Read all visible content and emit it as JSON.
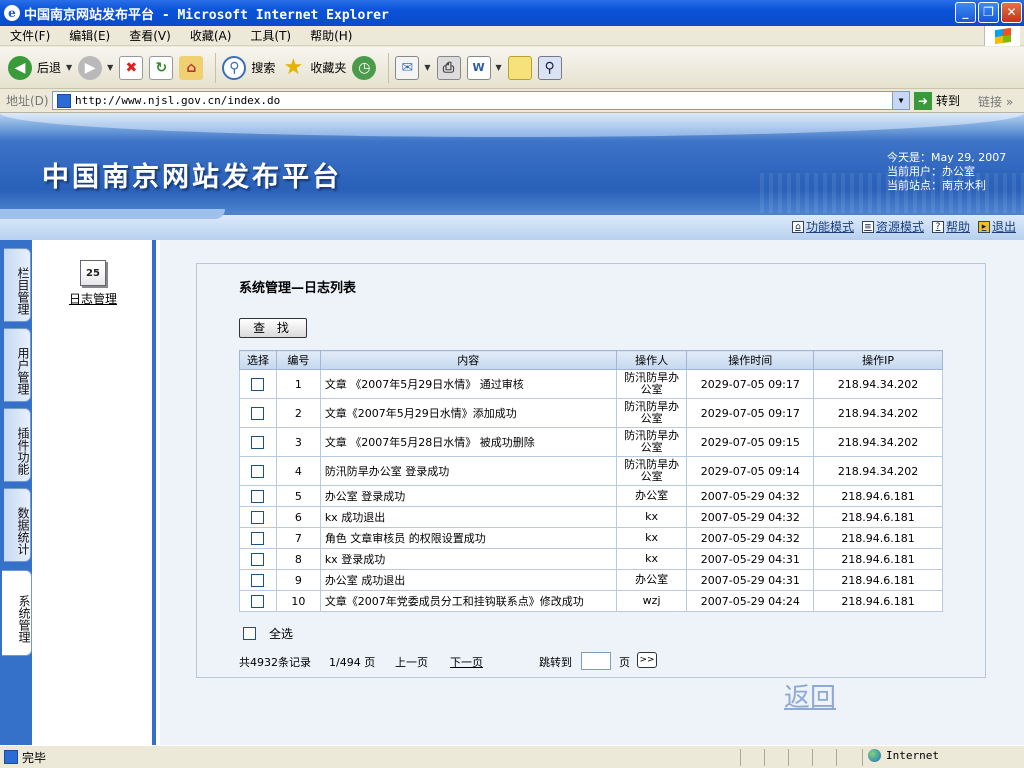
{
  "window": {
    "title": "中国南京网站发布平台 - Microsoft Internet Explorer",
    "controls": {
      "minimize": "_",
      "maximize": "❐",
      "close": "✕"
    }
  },
  "menu": [
    "文件(F)",
    "编辑(E)",
    "查看(V)",
    "收藏(A)",
    "工具(T)",
    "帮助(H)"
  ],
  "toolbar": {
    "back": "后退",
    "search": "搜索",
    "favorites": "收藏夹"
  },
  "address_bar": {
    "label": "地址(D)",
    "url": "http://www.njsl.gov.cn/index.do",
    "go": "转到",
    "links": "链接"
  },
  "banner": {
    "site_title": "中国南京网站发布平台",
    "today": "今天是：May 29, 2007",
    "current_user": "当前用户：办公室",
    "current_site": "当前站点：南京水利"
  },
  "mode_links": [
    {
      "label": "功能模式",
      "icon": "home-icon"
    },
    {
      "label": "资源模式",
      "icon": "document-icon"
    },
    {
      "label": "帮助",
      "icon": "help-icon"
    },
    {
      "label": "退出",
      "icon": "exit-icon"
    }
  ],
  "left_tabs": [
    "栏目管理",
    "用户管理",
    "插件功能",
    "数据统计",
    "系统管理"
  ],
  "active_tab": "系统管理",
  "panel": {
    "log_item": "日志管理",
    "calendar_day": "25"
  },
  "page": {
    "title": "系统管理—日志列表",
    "search_button": "查 找",
    "columns": [
      "选择",
      "编号",
      "内容",
      "操作人",
      "操作时间",
      "操作IP"
    ],
    "rows": [
      {
        "no": "1",
        "content": "文章 《2007年5月29日水情》 通过审核",
        "operator": "防汛防旱办公室",
        "time": "2029-07-05 09:17",
        "ip": "218.94.34.202"
      },
      {
        "no": "2",
        "content": "文章《2007年5月29日水情》添加成功",
        "operator": "防汛防旱办公室",
        "time": "2029-07-05 09:17",
        "ip": "218.94.34.202"
      },
      {
        "no": "3",
        "content": "文章 《2007年5月28日水情》 被成功删除",
        "operator": "防汛防旱办公室",
        "time": "2029-07-05 09:15",
        "ip": "218.94.34.202"
      },
      {
        "no": "4",
        "content": "防汛防旱办公室 登录成功",
        "operator": "防汛防旱办公室",
        "time": "2029-07-05 09:14",
        "ip": "218.94.34.202"
      },
      {
        "no": "5",
        "content": "办公室 登录成功",
        "operator": "办公室",
        "time": "2007-05-29 04:32",
        "ip": "218.94.6.181"
      },
      {
        "no": "6",
        "content": "kx 成功退出",
        "operator": "kx",
        "time": "2007-05-29 04:32",
        "ip": "218.94.6.181"
      },
      {
        "no": "7",
        "content": "角色 文章审核员 的权限设置成功",
        "operator": "kx",
        "time": "2007-05-29 04:32",
        "ip": "218.94.6.181"
      },
      {
        "no": "8",
        "content": "kx 登录成功",
        "operator": "kx",
        "time": "2007-05-29 04:31",
        "ip": "218.94.6.181"
      },
      {
        "no": "9",
        "content": "办公室 成功退出",
        "operator": "办公室",
        "time": "2007-05-29 04:31",
        "ip": "218.94.6.181"
      },
      {
        "no": "10",
        "content": "文章《2007年党委成员分工和挂钩联系点》修改成功",
        "operator": "wzj",
        "time": "2007-05-29 04:24",
        "ip": "218.94.6.181"
      }
    ],
    "select_all": "全选",
    "pager": {
      "total": "共4932条记录",
      "position": "1/494 页",
      "prev": "上一页",
      "next": "下一页",
      "jump_label": "跳转到",
      "page_unit": "页",
      "jump_button": ">>"
    },
    "back_link": "返回"
  },
  "status": {
    "text": "完毕",
    "zone": "Internet"
  }
}
